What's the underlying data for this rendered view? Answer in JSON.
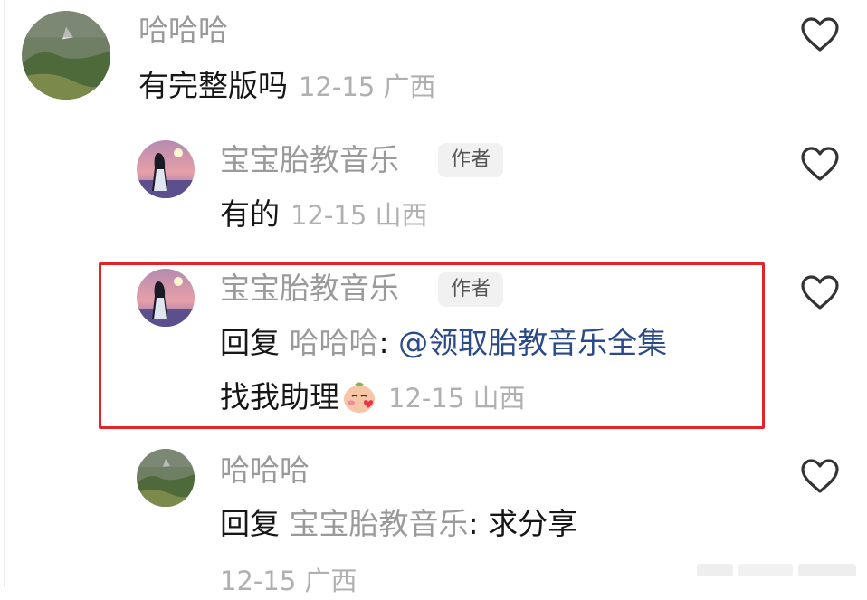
{
  "comments": [
    {
      "name": "哈哈哈",
      "text": "有完整版吗",
      "meta": "12-15 广西"
    },
    {
      "name": "宝宝胎教音乐",
      "badge": "作者",
      "text": "有的",
      "meta": "12-15 山西"
    },
    {
      "name": "宝宝胎教音乐",
      "badge": "作者",
      "reply_label": "回复",
      "reply_to": "哈哈哈",
      "colon": ":",
      "mention": "@领取胎教音乐全集",
      "text_line2": "找我助理",
      "emoji": "blush-kiss-emoji",
      "meta": "12-15 山西"
    },
    {
      "name": "哈哈哈",
      "reply_label": "回复",
      "reply_to": "宝宝胎教音乐",
      "colon": ":",
      "text": "求分享",
      "meta": "12-15 广西"
    }
  ],
  "colors": {
    "highlight_border": "#e4242b",
    "mention": "#2b4a8a",
    "muted": "#9a9a9a"
  },
  "icons": {
    "like": "heart-outline-icon"
  }
}
